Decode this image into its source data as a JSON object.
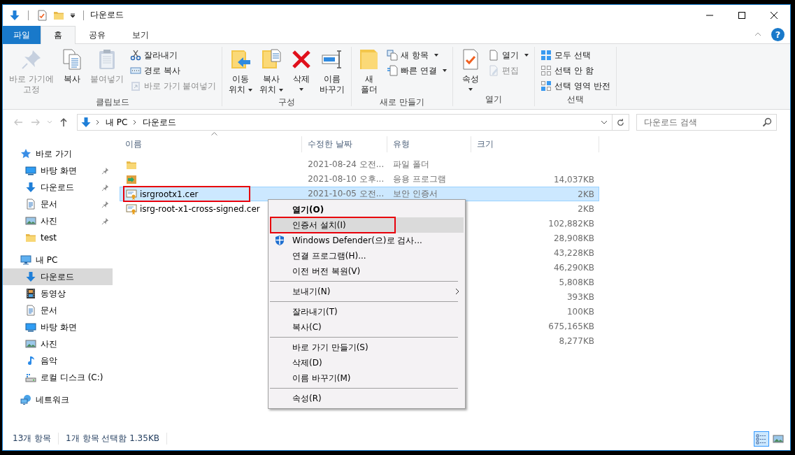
{
  "window": {
    "title": "다운로드"
  },
  "ribbon_tabs": [
    {
      "label": "파일",
      "kind": "file",
      "selected": false
    },
    {
      "label": "홈",
      "kind": "tab",
      "selected": true
    },
    {
      "label": "공유",
      "kind": "tab",
      "selected": false
    },
    {
      "label": "보기",
      "kind": "tab",
      "selected": false
    }
  ],
  "help_button": {
    "label": "?"
  },
  "ribbon_groups": [
    {
      "label": "클립보드",
      "commands": [
        {
          "label": "바로 가기에\n고정",
          "kind": "large",
          "disabled": true,
          "dropdown": false
        },
        {
          "label": "복사",
          "kind": "large",
          "disabled": false,
          "dropdown": false
        },
        {
          "label": "붙여넣기",
          "kind": "large",
          "disabled": true,
          "dropdown": false
        },
        {
          "label": "잘라내기",
          "kind": "small",
          "disabled": false,
          "dropdown": false
        },
        {
          "label": "경로 복사",
          "kind": "small",
          "disabled": false,
          "dropdown": false
        },
        {
          "label": "바로 가기 붙여넣기",
          "kind": "small",
          "disabled": true,
          "dropdown": false
        }
      ]
    },
    {
      "label": "구성",
      "commands": [
        {
          "label": "이동\n위치",
          "kind": "large",
          "disabled": false,
          "dropdown": true
        },
        {
          "label": "복사\n위치",
          "kind": "large",
          "disabled": false,
          "dropdown": true
        },
        {
          "label": "삭제",
          "kind": "large",
          "disabled": false,
          "dropdown": true
        },
        {
          "label": "이름\n바꾸기",
          "kind": "large",
          "disabled": false,
          "dropdown": false
        }
      ]
    },
    {
      "label": "새로 만들기",
      "commands": [
        {
          "label": "새\n폴더",
          "kind": "large",
          "disabled": false,
          "dropdown": false
        },
        {
          "label": "새 항목",
          "kind": "small",
          "disabled": false,
          "dropdown": true
        },
        {
          "label": "빠른 연결",
          "kind": "small",
          "disabled": false,
          "dropdown": true
        }
      ]
    },
    {
      "label": "열기",
      "commands": [
        {
          "label": "속성",
          "kind": "large",
          "disabled": false,
          "dropdown": true
        },
        {
          "label": "열기",
          "kind": "small",
          "disabled": false,
          "dropdown": true
        },
        {
          "label": "편집",
          "kind": "small",
          "disabled": true,
          "dropdown": false
        }
      ]
    },
    {
      "label": "선택",
      "commands": [
        {
          "label": "모두 선택",
          "kind": "small",
          "disabled": false,
          "dropdown": false
        },
        {
          "label": "선택 안 함",
          "kind": "small",
          "disabled": false,
          "dropdown": false
        },
        {
          "label": "선택 영역 반전",
          "kind": "small",
          "disabled": false,
          "dropdown": false
        }
      ]
    }
  ],
  "address": {
    "path": [
      "내 PC",
      "다운로드"
    ]
  },
  "search": {
    "placeholder": "다운로드 검색"
  },
  "nav": [
    {
      "label": "바로 가기",
      "selected": false,
      "children": [
        {
          "label": "바탕 화면",
          "pinned": true,
          "selected": false
        },
        {
          "label": "다운로드",
          "pinned": true,
          "selected": false
        },
        {
          "label": "문서",
          "pinned": true,
          "selected": false
        },
        {
          "label": "사진",
          "pinned": true,
          "selected": false
        },
        {
          "label": "test",
          "pinned": false,
          "selected": false
        }
      ]
    },
    {
      "label": "내 PC",
      "selected": false,
      "children": [
        {
          "label": "다운로드",
          "pinned": false,
          "selected": true
        },
        {
          "label": "동영상",
          "pinned": false,
          "selected": false
        },
        {
          "label": "문서",
          "pinned": false,
          "selected": false
        },
        {
          "label": "바탕 화면",
          "pinned": false,
          "selected": false
        },
        {
          "label": "사진",
          "pinned": false,
          "selected": false
        },
        {
          "label": "음악",
          "pinned": false,
          "selected": false
        },
        {
          "label": "로컬 디스크 (C:)",
          "pinned": false,
          "selected": false
        }
      ]
    },
    {
      "label": "네트워크",
      "selected": false
    }
  ],
  "columns": [
    {
      "label": "이름",
      "sorted": true
    },
    {
      "label": "수정한 날짜",
      "sorted": false
    },
    {
      "label": "유형",
      "sorted": false
    },
    {
      "label": "크기",
      "sorted": false
    }
  ],
  "rows": [
    {
      "kind": "folder",
      "date": "2021-08-24 오전...",
      "type": "파일 폴더",
      "selected": false,
      "annotated": false
    },
    {
      "kind": "program",
      "date": "2021-08-10 오후...",
      "type": "응용 프로그램",
      "size": "14,037KB",
      "selected": false,
      "annotated": false
    },
    {
      "kind": "certificate",
      "name": "isrgrootx1.cer",
      "date": "2021-10-05 오전...",
      "type": "보안 인증서",
      "size": "2KB",
      "selected": true,
      "annotated": true
    },
    {
      "kind": "certificate",
      "name": "isrg-root-x1-cross-signed.cer",
      "size": "2KB",
      "selected": false,
      "annotated": false
    },
    {
      "kind": "blank",
      "size": "102,882KB",
      "selected": false,
      "annotated": false
    },
    {
      "kind": "blank",
      "size": "28,908KB",
      "selected": false,
      "annotated": false
    },
    {
      "kind": "blank",
      "size": "43,228KB",
      "selected": false,
      "annotated": false
    },
    {
      "kind": "blank",
      "size": "46,290KB",
      "selected": false,
      "annotated": false
    },
    {
      "kind": "blank",
      "size": "5,808KB",
      "selected": false,
      "annotated": false
    },
    {
      "kind": "blank",
      "size": "393KB",
      "selected": false,
      "annotated": false
    },
    {
      "kind": "blank",
      "size": "100KB",
      "selected": false,
      "annotated": false
    },
    {
      "kind": "blank",
      "size": "675,165KB",
      "selected": false,
      "annotated": false
    },
    {
      "kind": "blank",
      "size": "8,277KB",
      "selected": false,
      "annotated": false
    }
  ],
  "context_menu": {
    "items": [
      {
        "kind": "item",
        "label": "열기(O)",
        "default": true,
        "highlighted": false,
        "annotated": false,
        "submenu": false
      },
      {
        "kind": "item",
        "label": "인증서 설치(I)",
        "default": false,
        "highlighted": true,
        "annotated": true,
        "submenu": false
      },
      {
        "kind": "defender",
        "label": "Windows Defender(으)로 검사...",
        "default": false,
        "highlighted": false,
        "annotated": false,
        "submenu": false
      },
      {
        "kind": "item",
        "label": "연결 프로그램(H)...",
        "default": false,
        "highlighted": false,
        "annotated": false,
        "submenu": false
      },
      {
        "kind": "item",
        "label": "이전 버전 복원(V)",
        "default": false,
        "highlighted": false,
        "annotated": false,
        "submenu": false
      },
      {
        "kind": "separator"
      },
      {
        "kind": "item",
        "label": "보내기(N)",
        "default": false,
        "highlighted": false,
        "annotated": false,
        "submenu": true
      },
      {
        "kind": "separator"
      },
      {
        "kind": "item",
        "label": "잘라내기(T)",
        "default": false,
        "highlighted": false,
        "annotated": false,
        "submenu": false
      },
      {
        "kind": "item",
        "label": "복사(C)",
        "default": false,
        "highlighted": false,
        "annotated": false,
        "submenu": false
      },
      {
        "kind": "separator"
      },
      {
        "kind": "item",
        "label": "바로 가기 만들기(S)",
        "default": false,
        "highlighted": false,
        "annotated": false,
        "submenu": false
      },
      {
        "kind": "item",
        "label": "삭제(D)",
        "default": false,
        "highlighted": false,
        "annotated": false,
        "submenu": false
      },
      {
        "kind": "item",
        "label": "이름 바꾸기(M)",
        "default": false,
        "highlighted": false,
        "annotated": false,
        "submenu": false
      },
      {
        "kind": "separator"
      },
      {
        "kind": "item",
        "label": "속성(R)",
        "default": false,
        "highlighted": false,
        "annotated": false,
        "submenu": false
      }
    ]
  },
  "status_bar": {
    "items": [
      "13개 항목",
      "1개 항목 선택함 1.35KB"
    ]
  },
  "view_buttons": [
    {
      "kind": "details",
      "selected": true
    },
    {
      "kind": "large-icons",
      "selected": false
    }
  ]
}
